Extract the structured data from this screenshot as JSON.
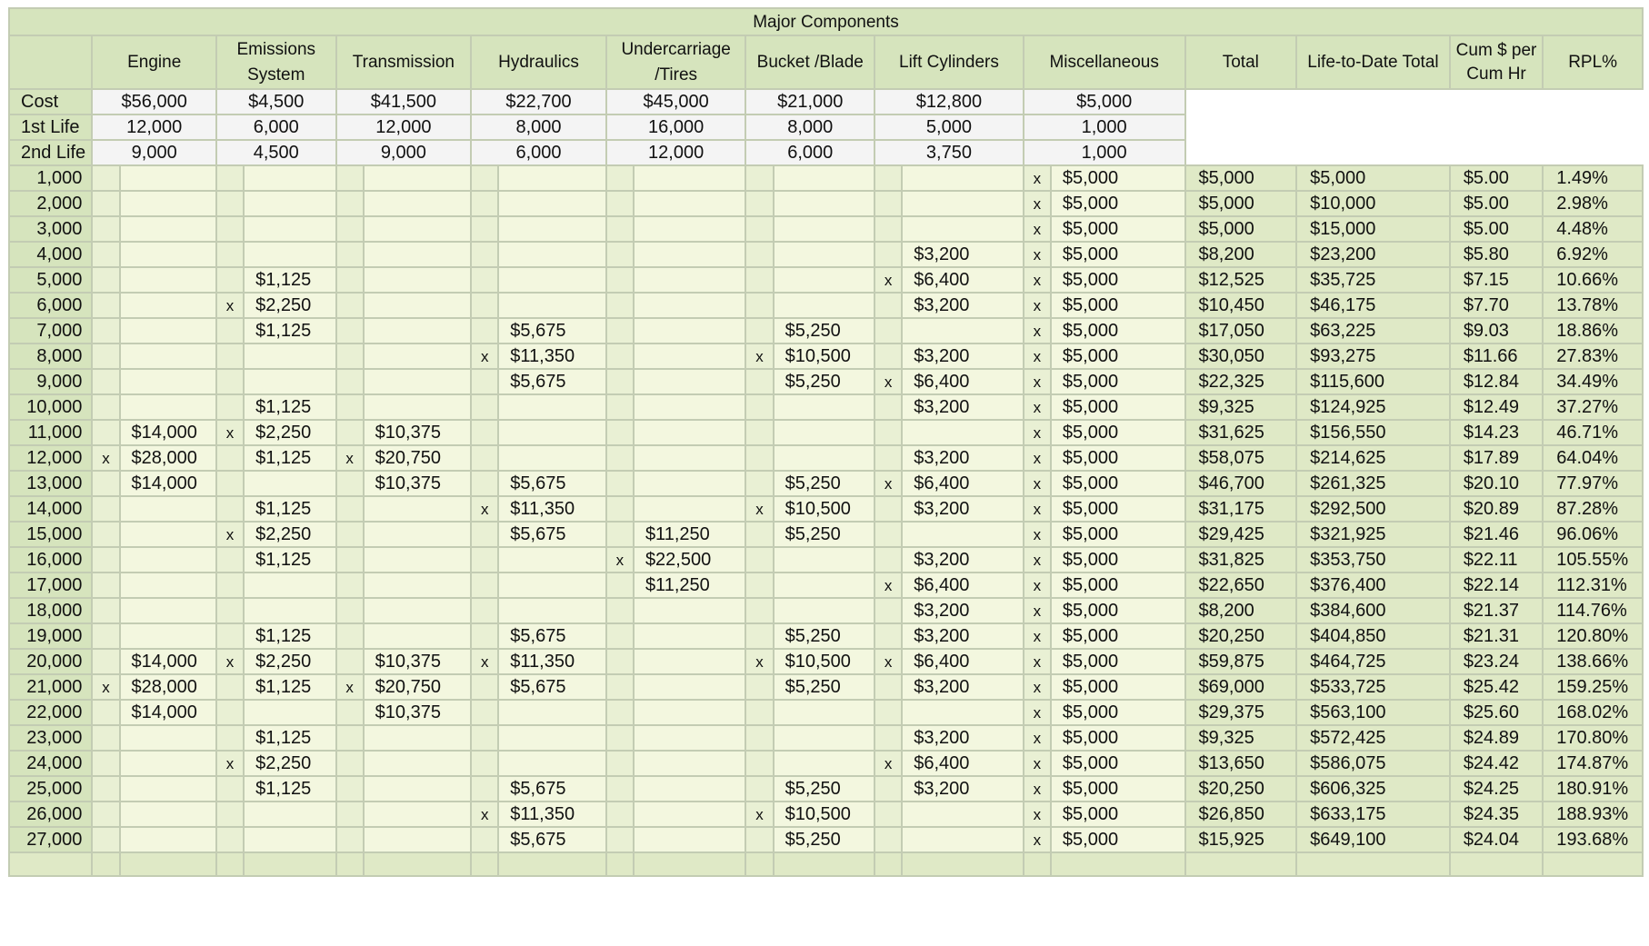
{
  "title": "Major Components",
  "components": [
    "Engine",
    "Emissions System",
    "Transmission",
    "Hydraulics",
    "Undercarriage /Tires",
    "Bucket /Blade",
    "Lift Cylinders",
    "Miscellaneous"
  ],
  "side_headers": {
    "total": "Total",
    "ltd_total": "Life-to-Date Total",
    "cum": "Cum $ per Cum Hr",
    "rpl": "RPL%"
  },
  "params": [
    {
      "label": "Cost",
      "values": [
        "$56,000",
        "$4,500",
        "$41,500",
        "$22,700",
        "$45,000",
        "$21,000",
        "$12,800",
        "$5,000"
      ]
    },
    {
      "label": "1st Life",
      "values": [
        "12,000",
        "6,000",
        "12,000",
        "8,000",
        "16,000",
        "8,000",
        "5,000",
        "1,000"
      ]
    },
    {
      "label": "2nd Life",
      "values": [
        "9,000",
        "4,500",
        "9,000",
        "6,000",
        "12,000",
        "6,000",
        "3,750",
        "1,000"
      ]
    }
  ],
  "rows": [
    {
      "hours": "1,000",
      "cells": [
        [
          "",
          ""
        ],
        [
          "",
          ""
        ],
        [
          "",
          ""
        ],
        [
          "",
          ""
        ],
        [
          "",
          ""
        ],
        [
          "",
          ""
        ],
        [
          "",
          ""
        ],
        [
          "x",
          "$5,000"
        ]
      ],
      "total": "$5,000",
      "ltd": "$5,000",
      "cum": "$5.00",
      "rpl": "1.49%"
    },
    {
      "hours": "2,000",
      "cells": [
        [
          "",
          ""
        ],
        [
          "",
          ""
        ],
        [
          "",
          ""
        ],
        [
          "",
          ""
        ],
        [
          "",
          ""
        ],
        [
          "",
          ""
        ],
        [
          "",
          ""
        ],
        [
          "x",
          "$5,000"
        ]
      ],
      "total": "$5,000",
      "ltd": "$10,000",
      "cum": "$5.00",
      "rpl": "2.98%"
    },
    {
      "hours": "3,000",
      "cells": [
        [
          "",
          ""
        ],
        [
          "",
          ""
        ],
        [
          "",
          ""
        ],
        [
          "",
          ""
        ],
        [
          "",
          ""
        ],
        [
          "",
          ""
        ],
        [
          "",
          ""
        ],
        [
          "x",
          "$5,000"
        ]
      ],
      "total": "$5,000",
      "ltd": "$15,000",
      "cum": "$5.00",
      "rpl": "4.48%"
    },
    {
      "hours": "4,000",
      "cells": [
        [
          "",
          ""
        ],
        [
          "",
          ""
        ],
        [
          "",
          ""
        ],
        [
          "",
          ""
        ],
        [
          "",
          ""
        ],
        [
          "",
          ""
        ],
        [
          "",
          "$3,200"
        ],
        [
          "x",
          "$5,000"
        ]
      ],
      "total": "$8,200",
      "ltd": "$23,200",
      "cum": "$5.80",
      "rpl": "6.92%"
    },
    {
      "hours": "5,000",
      "cells": [
        [
          "",
          ""
        ],
        [
          "",
          "$1,125"
        ],
        [
          "",
          ""
        ],
        [
          "",
          ""
        ],
        [
          "",
          ""
        ],
        [
          "",
          ""
        ],
        [
          "x",
          "$6,400"
        ],
        [
          "x",
          "$5,000"
        ]
      ],
      "total": "$12,525",
      "ltd": "$35,725",
      "cum": "$7.15",
      "rpl": "10.66%"
    },
    {
      "hours": "6,000",
      "cells": [
        [
          "",
          ""
        ],
        [
          "x",
          "$2,250"
        ],
        [
          "",
          ""
        ],
        [
          "",
          ""
        ],
        [
          "",
          ""
        ],
        [
          "",
          ""
        ],
        [
          "",
          "$3,200"
        ],
        [
          "x",
          "$5,000"
        ]
      ],
      "total": "$10,450",
      "ltd": "$46,175",
      "cum": "$7.70",
      "rpl": "13.78%"
    },
    {
      "hours": "7,000",
      "cells": [
        [
          "",
          ""
        ],
        [
          "",
          "$1,125"
        ],
        [
          "",
          ""
        ],
        [
          "",
          "$5,675"
        ],
        [
          "",
          ""
        ],
        [
          "",
          "$5,250"
        ],
        [
          "",
          ""
        ],
        [
          "x",
          "$5,000"
        ]
      ],
      "total": "$17,050",
      "ltd": "$63,225",
      "cum": "$9.03",
      "rpl": "18.86%"
    },
    {
      "hours": "8,000",
      "cells": [
        [
          "",
          ""
        ],
        [
          "",
          ""
        ],
        [
          "",
          ""
        ],
        [
          "x",
          "$11,350"
        ],
        [
          "",
          ""
        ],
        [
          "x",
          "$10,500"
        ],
        [
          "",
          "$3,200"
        ],
        [
          "x",
          "$5,000"
        ]
      ],
      "total": "$30,050",
      "ltd": "$93,275",
      "cum": "$11.66",
      "rpl": "27.83%"
    },
    {
      "hours": "9,000",
      "cells": [
        [
          "",
          ""
        ],
        [
          "",
          ""
        ],
        [
          "",
          ""
        ],
        [
          "",
          "$5,675"
        ],
        [
          "",
          ""
        ],
        [
          "",
          "$5,250"
        ],
        [
          "x",
          "$6,400"
        ],
        [
          "x",
          "$5,000"
        ]
      ],
      "total": "$22,325",
      "ltd": "$115,600",
      "cum": "$12.84",
      "rpl": "34.49%"
    },
    {
      "hours": "10,000",
      "cells": [
        [
          "",
          ""
        ],
        [
          "",
          "$1,125"
        ],
        [
          "",
          ""
        ],
        [
          "",
          ""
        ],
        [
          "",
          ""
        ],
        [
          "",
          ""
        ],
        [
          "",
          "$3,200"
        ],
        [
          "x",
          "$5,000"
        ]
      ],
      "total": "$9,325",
      "ltd": "$124,925",
      "cum": "$12.49",
      "rpl": "37.27%"
    },
    {
      "hours": "11,000",
      "cells": [
        [
          "",
          "$14,000"
        ],
        [
          "x",
          "$2,250"
        ],
        [
          "",
          "$10,375"
        ],
        [
          "",
          ""
        ],
        [
          "",
          ""
        ],
        [
          "",
          ""
        ],
        [
          "",
          ""
        ],
        [
          "x",
          "$5,000"
        ]
      ],
      "total": "$31,625",
      "ltd": "$156,550",
      "cum": "$14.23",
      "rpl": "46.71%"
    },
    {
      "hours": "12,000",
      "cells": [
        [
          "x",
          "$28,000"
        ],
        [
          "",
          "$1,125"
        ],
        [
          "x",
          "$20,750"
        ],
        [
          "",
          ""
        ],
        [
          "",
          ""
        ],
        [
          "",
          ""
        ],
        [
          "",
          "$3,200"
        ],
        [
          "x",
          "$5,000"
        ]
      ],
      "total": "$58,075",
      "ltd": "$214,625",
      "cum": "$17.89",
      "rpl": "64.04%"
    },
    {
      "hours": "13,000",
      "cells": [
        [
          "",
          "$14,000"
        ],
        [
          "",
          ""
        ],
        [
          "",
          "$10,375"
        ],
        [
          "",
          "$5,675"
        ],
        [
          "",
          ""
        ],
        [
          "",
          "$5,250"
        ],
        [
          "x",
          "$6,400"
        ],
        [
          "x",
          "$5,000"
        ]
      ],
      "total": "$46,700",
      "ltd": "$261,325",
      "cum": "$20.10",
      "rpl": "77.97%"
    },
    {
      "hours": "14,000",
      "cells": [
        [
          "",
          ""
        ],
        [
          "",
          "$1,125"
        ],
        [
          "",
          ""
        ],
        [
          "x",
          "$11,350"
        ],
        [
          "",
          ""
        ],
        [
          "x",
          "$10,500"
        ],
        [
          "",
          "$3,200"
        ],
        [
          "x",
          "$5,000"
        ]
      ],
      "total": "$31,175",
      "ltd": "$292,500",
      "cum": "$20.89",
      "rpl": "87.28%"
    },
    {
      "hours": "15,000",
      "cells": [
        [
          "",
          ""
        ],
        [
          "x",
          "$2,250"
        ],
        [
          "",
          ""
        ],
        [
          "",
          "$5,675"
        ],
        [
          "",
          "$11,250"
        ],
        [
          "",
          "$5,250"
        ],
        [
          "",
          ""
        ],
        [
          "x",
          "$5,000"
        ]
      ],
      "total": "$29,425",
      "ltd": "$321,925",
      "cum": "$21.46",
      "rpl": "96.06%"
    },
    {
      "hours": "16,000",
      "cells": [
        [
          "",
          ""
        ],
        [
          "",
          "$1,125"
        ],
        [
          "",
          ""
        ],
        [
          "",
          ""
        ],
        [
          "x",
          "$22,500"
        ],
        [
          "",
          ""
        ],
        [
          "",
          "$3,200"
        ],
        [
          "x",
          "$5,000"
        ]
      ],
      "total": "$31,825",
      "ltd": "$353,750",
      "cum": "$22.11",
      "rpl": "105.55%"
    },
    {
      "hours": "17,000",
      "cells": [
        [
          "",
          ""
        ],
        [
          "",
          ""
        ],
        [
          "",
          ""
        ],
        [
          "",
          ""
        ],
        [
          "",
          "$11,250"
        ],
        [
          "",
          ""
        ],
        [
          "x",
          "$6,400"
        ],
        [
          "x",
          "$5,000"
        ]
      ],
      "total": "$22,650",
      "ltd": "$376,400",
      "cum": "$22.14",
      "rpl": "112.31%"
    },
    {
      "hours": "18,000",
      "cells": [
        [
          "",
          ""
        ],
        [
          "",
          ""
        ],
        [
          "",
          ""
        ],
        [
          "",
          ""
        ],
        [
          "",
          ""
        ],
        [
          "",
          ""
        ],
        [
          "",
          "$3,200"
        ],
        [
          "x",
          "$5,000"
        ]
      ],
      "total": "$8,200",
      "ltd": "$384,600",
      "cum": "$21.37",
      "rpl": "114.76%"
    },
    {
      "hours": "19,000",
      "cells": [
        [
          "",
          ""
        ],
        [
          "",
          "$1,125"
        ],
        [
          "",
          ""
        ],
        [
          "",
          "$5,675"
        ],
        [
          "",
          ""
        ],
        [
          "",
          "$5,250"
        ],
        [
          "",
          "$3,200"
        ],
        [
          "x",
          "$5,000"
        ]
      ],
      "total": "$20,250",
      "ltd": "$404,850",
      "cum": "$21.31",
      "rpl": "120.80%"
    },
    {
      "hours": "20,000",
      "cells": [
        [
          "",
          "$14,000"
        ],
        [
          "x",
          "$2,250"
        ],
        [
          "",
          "$10,375"
        ],
        [
          "x",
          "$11,350"
        ],
        [
          "",
          ""
        ],
        [
          "x",
          "$10,500"
        ],
        [
          "x",
          "$6,400"
        ],
        [
          "x",
          "$5,000"
        ]
      ],
      "total": "$59,875",
      "ltd": "$464,725",
      "cum": "$23.24",
      "rpl": "138.66%"
    },
    {
      "hours": "21,000",
      "cells": [
        [
          "x",
          "$28,000"
        ],
        [
          "",
          "$1,125"
        ],
        [
          "x",
          "$20,750"
        ],
        [
          "",
          "$5,675"
        ],
        [
          "",
          ""
        ],
        [
          "",
          "$5,250"
        ],
        [
          "",
          "$3,200"
        ],
        [
          "x",
          "$5,000"
        ]
      ],
      "total": "$69,000",
      "ltd": "$533,725",
      "cum": "$25.42",
      "rpl": "159.25%"
    },
    {
      "hours": "22,000",
      "cells": [
        [
          "",
          "$14,000"
        ],
        [
          "",
          ""
        ],
        [
          "",
          "$10,375"
        ],
        [
          "",
          ""
        ],
        [
          "",
          ""
        ],
        [
          "",
          ""
        ],
        [
          "",
          ""
        ],
        [
          "x",
          "$5,000"
        ]
      ],
      "total": "$29,375",
      "ltd": "$563,100",
      "cum": "$25.60",
      "rpl": "168.02%"
    },
    {
      "hours": "23,000",
      "cells": [
        [
          "",
          ""
        ],
        [
          "",
          "$1,125"
        ],
        [
          "",
          ""
        ],
        [
          "",
          ""
        ],
        [
          "",
          ""
        ],
        [
          "",
          ""
        ],
        [
          "",
          "$3,200"
        ],
        [
          "x",
          "$5,000"
        ]
      ],
      "total": "$9,325",
      "ltd": "$572,425",
      "cum": "$24.89",
      "rpl": "170.80%"
    },
    {
      "hours": "24,000",
      "cells": [
        [
          "",
          ""
        ],
        [
          "x",
          "$2,250"
        ],
        [
          "",
          ""
        ],
        [
          "",
          ""
        ],
        [
          "",
          ""
        ],
        [
          "",
          ""
        ],
        [
          "x",
          "$6,400"
        ],
        [
          "x",
          "$5,000"
        ]
      ],
      "total": "$13,650",
      "ltd": "$586,075",
      "cum": "$24.42",
      "rpl": "174.87%"
    },
    {
      "hours": "25,000",
      "cells": [
        [
          "",
          ""
        ],
        [
          "",
          "$1,125"
        ],
        [
          "",
          ""
        ],
        [
          "",
          "$5,675"
        ],
        [
          "",
          ""
        ],
        [
          "",
          "$5,250"
        ],
        [
          "",
          "$3,200"
        ],
        [
          "x",
          "$5,000"
        ]
      ],
      "total": "$20,250",
      "ltd": "$606,325",
      "cum": "$24.25",
      "rpl": "180.91%"
    },
    {
      "hours": "26,000",
      "cells": [
        [
          "",
          ""
        ],
        [
          "",
          ""
        ],
        [
          "",
          ""
        ],
        [
          "x",
          "$11,350"
        ],
        [
          "",
          ""
        ],
        [
          "x",
          "$10,500"
        ],
        [
          "",
          ""
        ],
        [
          "x",
          "$5,000"
        ]
      ],
      "total": "$26,850",
      "ltd": "$633,175",
      "cum": "$24.35",
      "rpl": "188.93%"
    },
    {
      "hours": "27,000",
      "cells": [
        [
          "",
          ""
        ],
        [
          "",
          ""
        ],
        [
          "",
          ""
        ],
        [
          "",
          "$5,675"
        ],
        [
          "",
          ""
        ],
        [
          "",
          "$5,250"
        ],
        [
          "",
          ""
        ],
        [
          "x",
          "$5,000"
        ]
      ],
      "total": "$15,925",
      "ltd": "$649,100",
      "cum": "$24.04",
      "rpl": "193.68%"
    }
  ]
}
